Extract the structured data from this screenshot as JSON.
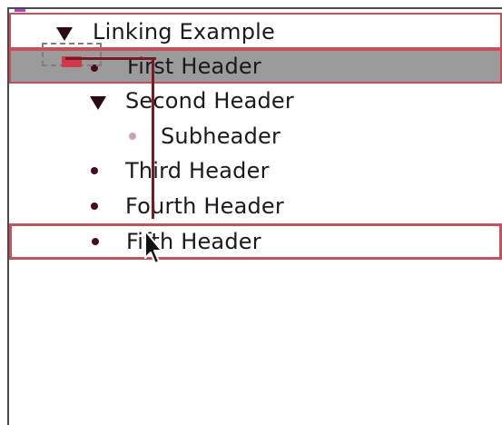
{
  "outline": {
    "collapse_indicator": "minus-icon",
    "root": {
      "label": "Linking Example",
      "icon": "disclosure-triangle-expanded-icon"
    },
    "items": [
      {
        "label": "First Header",
        "icon": "bullet-icon",
        "state": "selected-drag-source"
      },
      {
        "label": "Second Header",
        "icon": "disclosure-triangle-expanded-icon"
      },
      {
        "label": "Subheader",
        "icon": "bullet-icon-light"
      },
      {
        "label": "Third Header",
        "icon": "bullet-icon"
      },
      {
        "label": "Fourth Header",
        "icon": "bullet-icon"
      },
      {
        "label": "Fifth Header",
        "icon": "bullet-icon",
        "state": "drop-target"
      }
    ]
  },
  "colors": {
    "selection": "#9b9b9b",
    "highlight_border": "#c2525b",
    "link_line": "#7a1a22",
    "bullet": "#4b0a1a",
    "minus": "#b640c8"
  },
  "cursor": "drag-arrow-cursor-icon"
}
